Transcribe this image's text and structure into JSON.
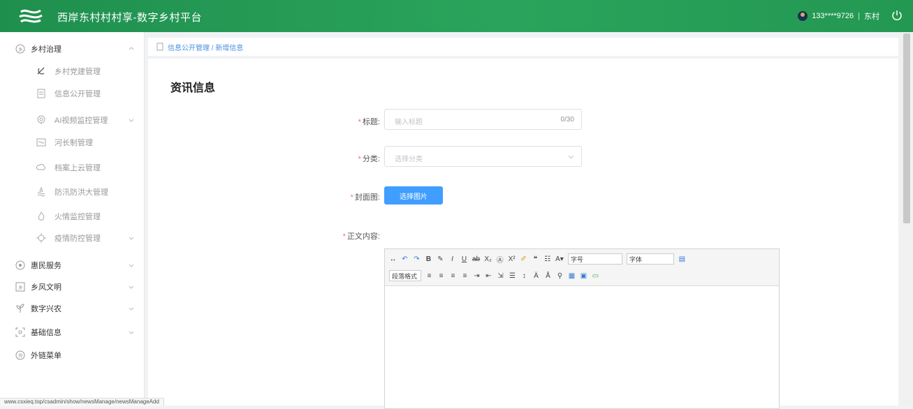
{
  "header": {
    "title": "西岸东村村村享-数字乡村平台",
    "user_phone": "133****9726",
    "separator": "|",
    "user_village": "东村",
    "brand_color": "#2aa45c"
  },
  "sidebar": {
    "items": [
      {
        "label": "乡村治理",
        "icon": "governance-icon",
        "expanded": true
      },
      {
        "label": "乡村党建管理",
        "icon": "party-icon",
        "sub": true
      },
      {
        "label": "信息公开管理",
        "icon": "document-icon",
        "sub": true
      },
      {
        "label": "AI视频监控管理",
        "icon": "camera-icon",
        "sub": true
      },
      {
        "label": "河长制管理",
        "icon": "river-icon",
        "sub": true
      },
      {
        "label": "档案上云管理",
        "icon": "cloud-archive-icon",
        "sub": true
      },
      {
        "label": "防汛防洪大管理",
        "icon": "flood-icon",
        "sub": true
      },
      {
        "label": "火情监控管理",
        "icon": "fire-icon",
        "sub": true
      },
      {
        "label": "疫情防控管理",
        "icon": "epidemic-icon",
        "sub": true
      },
      {
        "label": "惠民服务",
        "icon": "service-icon"
      },
      {
        "label": "乡风文明",
        "icon": "culture-icon"
      },
      {
        "label": "数字兴农",
        "icon": "agriculture-icon"
      },
      {
        "label": "基础信息",
        "icon": "info-icon"
      },
      {
        "label": "外链菜单",
        "icon": "link-icon"
      }
    ]
  },
  "breadcrumb": {
    "path": "信息公开管理 / 新增信息"
  },
  "main": {
    "page_title": "资讯信息",
    "form": {
      "title_label": "标题:",
      "title_placeholder": "输入标题",
      "title_count": "0/30",
      "category_label": "分类:",
      "category_placeholder": "选择分类",
      "cover_label": "封面图:",
      "cover_button": "选择图片",
      "content_label": "正文内容:"
    },
    "editor": {
      "font_size_select": "字号",
      "font_family_select": "字体",
      "paragraph_select": "段落格式"
    }
  },
  "status_bar": {
    "url": "www.csxieq.top/csadmin/show/newsManage/newsManageAdd"
  }
}
